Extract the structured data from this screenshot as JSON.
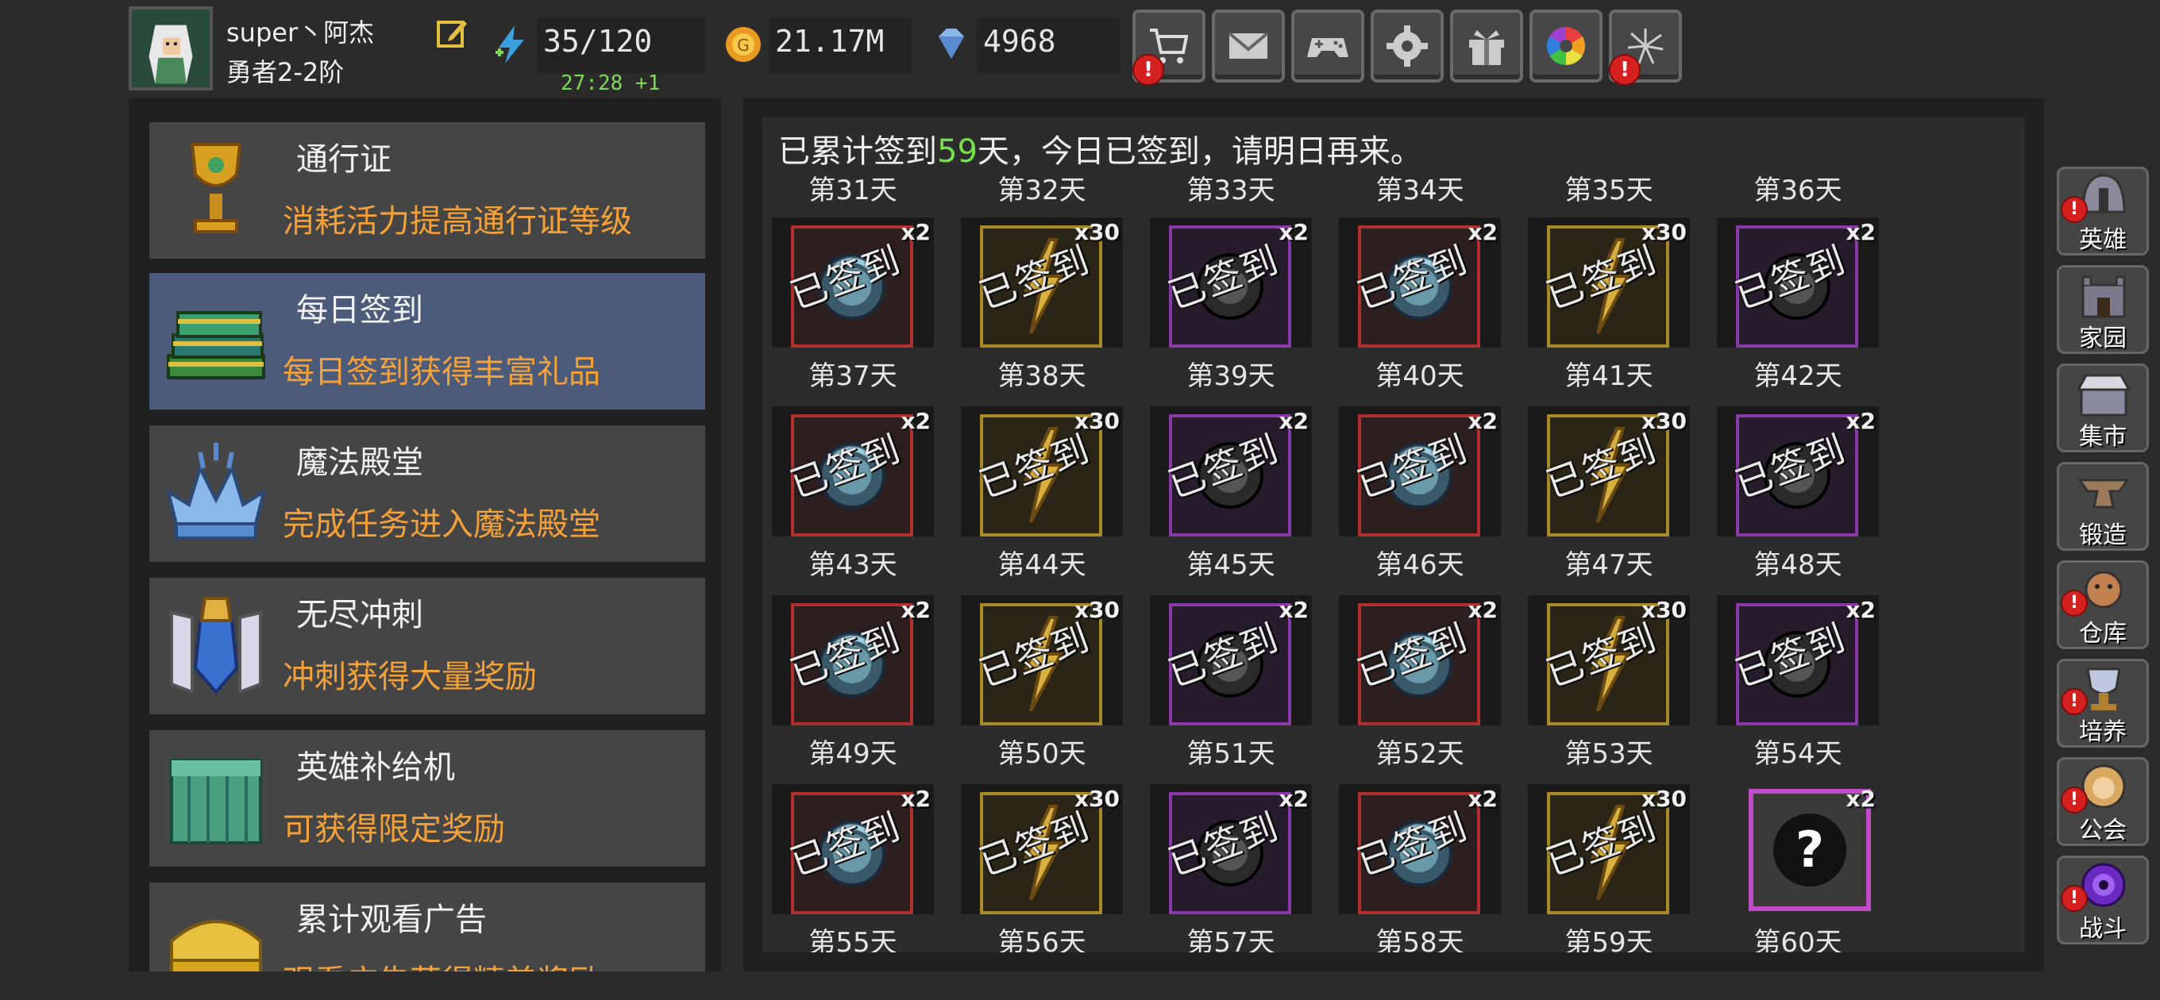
{
  "player": {
    "name": "super丶阿杰",
    "rank": "勇者2-2阶"
  },
  "resources": {
    "energy": "35/120",
    "energy_timer": "27:28 +1",
    "gold": "21.17M",
    "gems": "4968"
  },
  "toolbar": [
    {
      "name": "shop-button",
      "icon": "cart-icon",
      "alert": true
    },
    {
      "name": "mail-button",
      "icon": "mail-icon",
      "alert": false
    },
    {
      "name": "gamepad-button",
      "icon": "gamepad-icon",
      "alert": false
    },
    {
      "name": "settings-button",
      "icon": "gear-icon",
      "alert": false
    },
    {
      "name": "gift-button",
      "icon": "gift-icon",
      "alert": false
    },
    {
      "name": "color-wheel-button",
      "icon": "color-wheel-icon",
      "alert": false
    },
    {
      "name": "fireworks-button",
      "icon": "fireworks-icon",
      "alert": true
    }
  ],
  "left_menu": [
    {
      "title": "通行证",
      "desc": "消耗活力提高通行证等级",
      "icon": "chalice-icon",
      "active": false
    },
    {
      "title": "每日签到",
      "desc": "每日签到获得丰富礼品",
      "icon": "book-stack-icon",
      "active": true
    },
    {
      "title": "魔法殿堂",
      "desc": "完成任务进入魔法殿堂",
      "icon": "crystal-crown-icon",
      "active": false
    },
    {
      "title": "无尽冲刺",
      "desc": "冲刺获得大量奖励",
      "icon": "armor-icon",
      "active": false
    },
    {
      "title": "英雄补给机",
      "desc": "可获得限定奖励",
      "icon": "jade-block-icon",
      "active": false
    },
    {
      "title": "累计观看广告",
      "desc": "观看广告获得精美奖励",
      "icon": "gold-chest-icon",
      "active": false
    }
  ],
  "signin": {
    "msg_prefix": "已累计签到",
    "days": "59",
    "msg_suffix": "天，今日已签到，请明日再来。",
    "stamp": "已签到",
    "top_labels": [
      "第31天",
      "第32天",
      "第33天",
      "第34天",
      "第35天",
      "第36天"
    ],
    "rows": [
      [
        {
          "day": "第37天",
          "qty": "x2",
          "rarity": "red",
          "item": "orb-icon",
          "signed": true
        },
        {
          "day": "第38天",
          "qty": "x30",
          "rarity": "gold",
          "item": "lightning-icon",
          "signed": true
        },
        {
          "day": "第39天",
          "qty": "x2",
          "rarity": "purple",
          "item": "mystery-orb-icon",
          "signed": true
        },
        {
          "day": "第40天",
          "qty": "x2",
          "rarity": "red",
          "item": "orb-icon",
          "signed": true
        },
        {
          "day": "第41天",
          "qty": "x30",
          "rarity": "gold",
          "item": "lightning-icon",
          "signed": true
        },
        {
          "day": "第42天",
          "qty": "x2",
          "rarity": "purple",
          "item": "mystery-orb-icon",
          "signed": true
        }
      ],
      [
        {
          "day": "第43天",
          "qty": "x2",
          "rarity": "red",
          "item": "orb-icon",
          "signed": true
        },
        {
          "day": "第44天",
          "qty": "x30",
          "rarity": "gold",
          "item": "lightning-icon",
          "signed": true
        },
        {
          "day": "第45天",
          "qty": "x2",
          "rarity": "purple",
          "item": "mystery-orb-icon",
          "signed": true
        },
        {
          "day": "第46天",
          "qty": "x2",
          "rarity": "red",
          "item": "orb-icon",
          "signed": true
        },
        {
          "day": "第47天",
          "qty": "x30",
          "rarity": "gold",
          "item": "lightning-icon",
          "signed": true
        },
        {
          "day": "第48天",
          "qty": "x2",
          "rarity": "purple",
          "item": "mystery-orb-icon",
          "signed": true
        }
      ],
      [
        {
          "day": "第49天",
          "qty": "x2",
          "rarity": "red",
          "item": "orb-icon",
          "signed": true
        },
        {
          "day": "第50天",
          "qty": "x30",
          "rarity": "gold",
          "item": "lightning-icon",
          "signed": true
        },
        {
          "day": "第51天",
          "qty": "x2",
          "rarity": "purple",
          "item": "mystery-orb-icon",
          "signed": true
        },
        {
          "day": "第52天",
          "qty": "x2",
          "rarity": "red",
          "item": "orb-icon",
          "signed": true
        },
        {
          "day": "第53天",
          "qty": "x30",
          "rarity": "gold",
          "item": "lightning-icon",
          "signed": true
        },
        {
          "day": "第54天",
          "qty": "x2",
          "rarity": "purple",
          "item": "mystery-orb-icon",
          "signed": true
        }
      ],
      [
        {
          "day": "第55天",
          "qty": "x2",
          "rarity": "red",
          "item": "orb-icon",
          "signed": true
        },
        {
          "day": "第56天",
          "qty": "x30",
          "rarity": "gold",
          "item": "lightning-icon",
          "signed": true
        },
        {
          "day": "第57天",
          "qty": "x2",
          "rarity": "purple",
          "item": "mystery-orb-icon",
          "signed": true
        },
        {
          "day": "第58天",
          "qty": "x2",
          "rarity": "red",
          "item": "orb-icon",
          "signed": true
        },
        {
          "day": "第59天",
          "qty": "x30",
          "rarity": "gold",
          "item": "lightning-icon",
          "signed": true
        },
        {
          "day": "第60天",
          "qty": "x2",
          "rarity": "purple",
          "item": "question-mark-icon",
          "signed": false
        }
      ]
    ]
  },
  "right_nav": [
    {
      "label": "英雄",
      "icon": "helmet-icon",
      "alert": true
    },
    {
      "label": "家园",
      "icon": "castle-icon",
      "alert": false
    },
    {
      "label": "集市",
      "icon": "market-icon",
      "alert": false
    },
    {
      "label": "锻造",
      "icon": "anvil-icon",
      "alert": false
    },
    {
      "label": "仓库",
      "icon": "warehouse-icon",
      "alert": true
    },
    {
      "label": "培养",
      "icon": "trophy-icon",
      "alert": true
    },
    {
      "label": "公会",
      "icon": "lion-icon",
      "alert": true
    },
    {
      "label": "战斗",
      "icon": "portal-icon",
      "alert": true
    }
  ],
  "colors": {
    "accent_orange": "#f5a13a",
    "highlight_green": "#74e04a",
    "active_card": "#4b5b79",
    "alert_red": "#d52020"
  }
}
